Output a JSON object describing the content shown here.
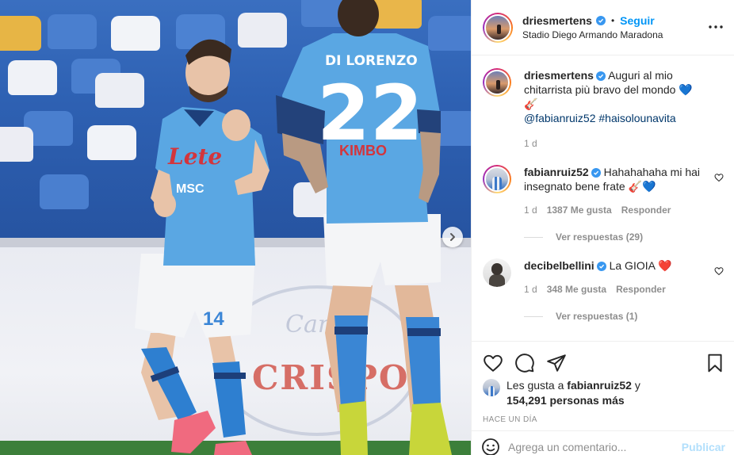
{
  "post": {
    "username": "driesmertens",
    "follow_label": "Seguir",
    "separator": "•",
    "location": "Stadio Diego Armando Maradona",
    "more_icon": "more-options-icon"
  },
  "photo": {
    "ad_text": "CRISPO",
    "ad_script": "Carlo",
    "player_left": {
      "sponsor": "Lete",
      "sponsor2": "MSC",
      "number": "14"
    },
    "player_right": {
      "name": "DI LORENZO",
      "number": "22",
      "sponsor": "KIMBO"
    }
  },
  "caption": {
    "username": "driesmertens",
    "text": "Auguri al mio chitarrista più bravo del mondo 💙🎸",
    "mention": "@fabianruiz52",
    "hashtag": "#haisolounavita",
    "time": "1 d"
  },
  "comments": [
    {
      "username": "fabianruiz52",
      "text": "Hahahahaha mi hai insegnato bene frate 🎸💙",
      "time": "1 d",
      "likes": "1387 Me gusta",
      "reply": "Responder",
      "view_replies": "Ver respuestas (29)"
    },
    {
      "username": "decibelbellini",
      "text": "La GIOIA ❤️",
      "time": "1 d",
      "likes": "348 Me gusta",
      "reply": "Responder",
      "view_replies": "Ver respuestas (1)"
    }
  ],
  "likes": {
    "prefix": "Les gusta a",
    "user": "fabianruiz52",
    "connector": "y",
    "others": "154,291 personas más"
  },
  "timestamp": "Hace un día",
  "comment_input": {
    "placeholder": "Agrega un comentario...",
    "publish": "Publicar"
  },
  "colors": {
    "accent": "#0095f6",
    "verified": "#3897f0",
    "publish_disabled": "#b2dffc",
    "muted": "#8e8e8e"
  }
}
